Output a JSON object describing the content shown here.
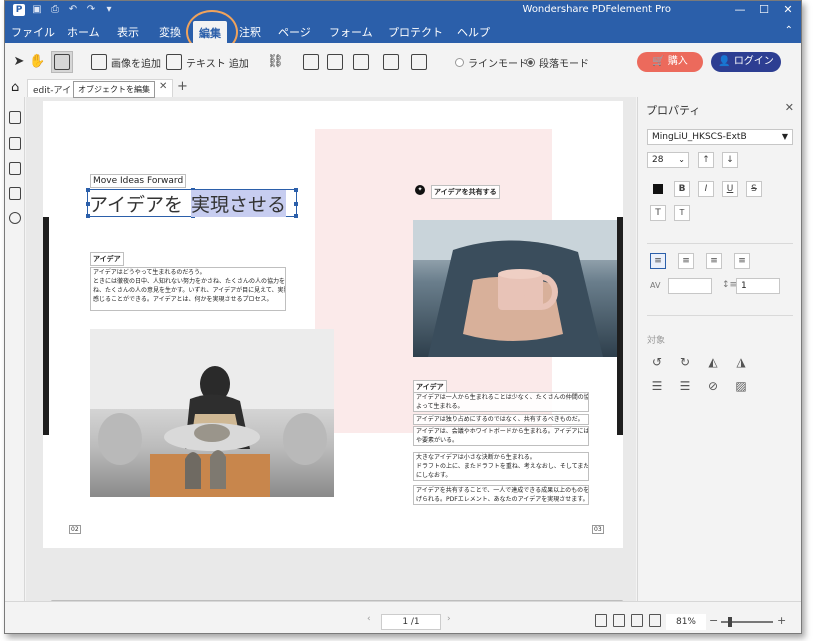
{
  "window": {
    "title": "Wondershare PDFelement Pro"
  },
  "menu": {
    "items": [
      {
        "name": "menu-file",
        "label": "ファイル"
      },
      {
        "name": "menu-home",
        "label": "ホーム"
      },
      {
        "name": "menu-view",
        "label": "表示"
      },
      {
        "name": "menu-convert",
        "label": "変換"
      },
      {
        "name": "menu-edit",
        "label": "編集"
      },
      {
        "name": "menu-comment",
        "label": "注釈"
      },
      {
        "name": "menu-page",
        "label": "ページ"
      },
      {
        "name": "menu-form",
        "label": "フォーム"
      },
      {
        "name": "menu-protect",
        "label": "プロテクト"
      },
      {
        "name": "menu-help",
        "label": "ヘルプ"
      }
    ],
    "active": "編集"
  },
  "toolbar": {
    "add_image_label": "画像を追加",
    "add_text_label": "テキスト 追加",
    "line_mode_label": "ラインモード",
    "paragraph_mode_label": "段落モード",
    "buy_label": "購入",
    "login_label": "ログイン",
    "tooltip": "オブジェクトを編集"
  },
  "tabs": {
    "doc_tab_label": "edit-アイ",
    "add_tab": "+"
  },
  "document": {
    "left_page": {
      "small_title": "Move Ideas Forward",
      "big_title_normal": "アイデアを",
      "big_title_selected": "実現させる",
      "section_heading": "アイデア",
      "body_lines": [
        "アイデアはどうやって生まれるのだろう。",
        "ときには徹夜の日中、人知れない努力をかさね、たくさんの人の協力をかさ",
        "ね、たくさんの人の意見を生かす。いずれ、アイデアが目に見えて、実際に",
        "感じることができる。アイデアとは、何かを実現させるプロセス。"
      ],
      "page_number": "02"
    },
    "right_page": {
      "share_heading": "アイデアを共有する",
      "section_heading": "アイデア",
      "para1": [
        "アイデアは一人から生まれることは少なく、たくさんの仲間の協力に",
        "よって生まれる。"
      ],
      "para2": "アイデアは独り占めにするのではなく、共有するべきものだ。",
      "para3": [
        "アイデアは、会議やホワイトボードから生まれる。アイデアには意味",
        "や要素がいる。"
      ],
      "para4": [
        "大きなアイデアは小さな決断から生まれる。",
        "ドラフトの上に、またドラフトを重ね、考えなおし、そしてまた、形",
        "にしなおす。"
      ],
      "para5": [
        "アイデアを共有することで、一人で達成できる成果以上のものを成し遂",
        "げられる。PDFエレメント、あなたのアイデアを実現させます。"
      ],
      "page_number": "03"
    }
  },
  "properties": {
    "title": "プロパティ",
    "font_name": "MingLiU_HKSCS-ExtB",
    "font_size": "28",
    "spacing_value": "1",
    "section_object_label": "対象",
    "format_buttons": [
      "B",
      "I",
      "U",
      "S"
    ],
    "superscript": "T",
    "subscript": "T"
  },
  "status": {
    "page_indicator": "1 /1",
    "zoom": "81%"
  },
  "colors": {
    "title_bar": "#2b5faa",
    "buy_button": "#ec6a5c",
    "login_button": "#2d3e92",
    "highlight_circle": "#f0a35c",
    "selection": "#2b5faa"
  }
}
